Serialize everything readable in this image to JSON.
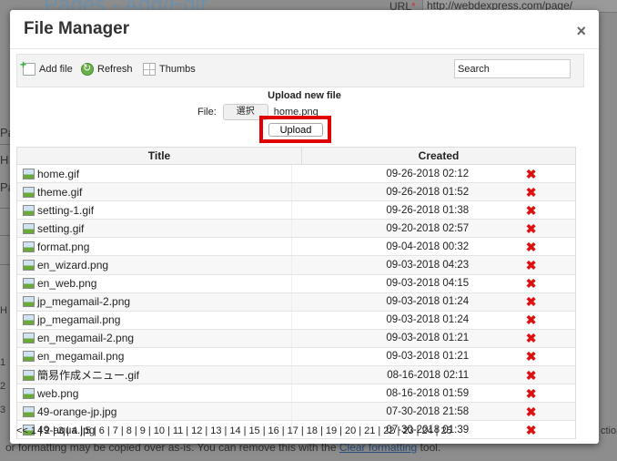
{
  "background": {
    "page_title": "Pages - Add/Edit",
    "url_label": "URL",
    "url_required": "*",
    "url_value": "http://webdexpress.com/page/",
    "left_labels": [
      "Pa",
      "H",
      "Pa",
      "H",
      "1",
      "2",
      "3"
    ],
    "bottom_text_prefix": "or formatting may be copied over as-is. You can remove this with the ",
    "bottom_link": "Clear formatting",
    "bottom_text_suffix": " tool.",
    "right_text": "ction"
  },
  "dialog": {
    "title": "File Manager",
    "close_symbol": "×",
    "toolbar": {
      "add_file_label": "Add file",
      "refresh_label": "Refresh",
      "thumbs_label": "Thumbs",
      "search_value": "Search"
    },
    "upload": {
      "title": "Upload new file",
      "file_label": "File:",
      "choose_button": "選択",
      "selected_file": "home.png",
      "upload_button": "Upload"
    },
    "table": {
      "headers": {
        "title": "Title",
        "created": "Created"
      },
      "rows": [
        {
          "title": "home.gif",
          "created": "09-26-2018 02:12"
        },
        {
          "title": "theme.gif",
          "created": "09-26-2018 01:52"
        },
        {
          "title": "setting-1.gif",
          "created": "09-26-2018 01:38"
        },
        {
          "title": "setting.gif",
          "created": "09-20-2018 02:57"
        },
        {
          "title": "format.png",
          "created": "09-04-2018 00:32"
        },
        {
          "title": "en_wizard.png",
          "created": "09-03-2018 04:23"
        },
        {
          "title": "en_web.png",
          "created": "09-03-2018 04:15"
        },
        {
          "title": "jp_megamail-2.png",
          "created": "09-03-2018 01:24"
        },
        {
          "title": "jp_megamail.png",
          "created": "09-03-2018 01:24"
        },
        {
          "title": "en_megamail-2.png",
          "created": "09-03-2018 01:21"
        },
        {
          "title": "en_megamail.png",
          "created": "09-03-2018 01:21"
        },
        {
          "title": "簡易作成メニュー.gif",
          "created": "08-16-2018 02:11"
        },
        {
          "title": "web.png",
          "created": "08-16-2018 01:59"
        },
        {
          "title": "49-orange-jp.jpg",
          "created": "07-30-2018 21:58"
        },
        {
          "title": "49-aqua.jpg",
          "created": "07-30-2018 01:39"
        }
      ]
    },
    "pager": [
      "<<",
      "1",
      "2",
      "3",
      "4",
      "5",
      "6",
      "7",
      "8",
      "9",
      "10",
      "11",
      "12",
      "13",
      "14",
      "15",
      "16",
      "17",
      "18",
      "19",
      "20",
      "21",
      "22",
      "23",
      "24",
      "25"
    ]
  },
  "colors": {
    "highlight_border": "#e00000",
    "delete_icon": "#dd1111"
  },
  "icons": {
    "close": "close-icon",
    "add_file": "add-file-icon",
    "refresh": "refresh-icon",
    "thumbs": "thumbs-icon",
    "file": "image-file-icon",
    "delete": "delete-icon"
  }
}
